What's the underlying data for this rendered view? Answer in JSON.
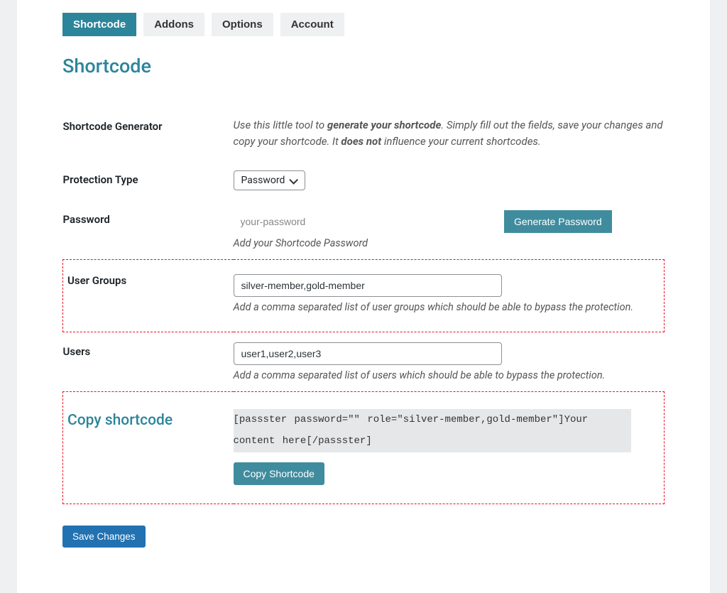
{
  "tabs": {
    "shortcode": "Shortcode",
    "addons": "Addons",
    "options": "Options",
    "account": "Account"
  },
  "page_title": "Shortcode",
  "sections": {
    "generator": {
      "label": "Shortcode Generator",
      "intro_prefix": "Use this little tool to ",
      "intro_bold1": "generate your shortcode",
      "intro_mid": ". Simply fill out the fields, save your changes and copy your shortcode. It ",
      "intro_bold2": "does not",
      "intro_suffix": " influence your current shortcodes."
    },
    "protection_type": {
      "label": "Protection Type",
      "value": "Password"
    },
    "password": {
      "label": "Password",
      "placeholder": "your-password",
      "button": "Generate Password",
      "description": "Add your Shortcode Password"
    },
    "user_groups": {
      "label": "User Groups",
      "value": "silver-member,gold-member",
      "description": "Add a comma separated list of user groups which should be able to bypass the protection."
    },
    "users": {
      "label": "Users",
      "value": "user1,user2,user3",
      "description": "Add a comma separated list of users which should be able to bypass the protection."
    },
    "copy": {
      "label": "Copy shortcode",
      "output": " [passster password=\"\" role=\"silver-member,gold-member\"]Your content here[/passster]",
      "button": "Copy Shortcode"
    }
  },
  "save_label": "Save Changes"
}
